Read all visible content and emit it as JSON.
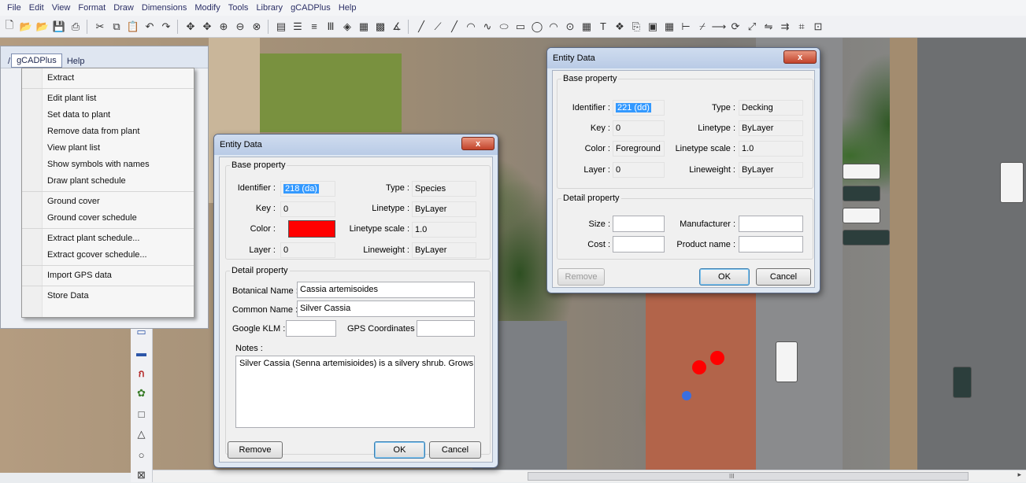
{
  "menubar": [
    "File",
    "Edit",
    "View",
    "Format",
    "Draw",
    "Dimensions",
    "Modify",
    "Tools",
    "Library",
    "gCADPlus",
    "Help"
  ],
  "toolbar_icons": [
    "new-icon",
    "open-icon",
    "open-icon",
    "save-icon",
    "print-icon",
    "cut-icon",
    "copy-icon",
    "paste-icon",
    "undo-icon",
    "redo-icon",
    "pan-icon",
    "pan-icon",
    "zoom-in-icon",
    "zoom-out-icon",
    "zoom-window-icon",
    "layers-icon",
    "properties-icon",
    "lineweight-icon",
    "linetype-icon",
    "color-icon",
    "match-icon",
    "hatch-icon",
    "dimension-icon",
    "line-icon",
    "polyline-icon",
    "line-icon",
    "arc-icon",
    "spline-icon",
    "ellipse-icon",
    "rectangle-icon",
    "circle-icon",
    "arc-icon",
    "donut-icon",
    "table-icon",
    "text-icon",
    "block-icon",
    "insert-icon",
    "image-icon",
    "table-icon",
    "measure-icon",
    "trim-icon",
    "extend-icon",
    "rotate-icon",
    "scale-icon",
    "mirror-icon",
    "offset-icon",
    "snap-icon",
    "osnap-icon"
  ],
  "left_panel": {
    "tabs": [
      "gCADPlus",
      "Help"
    ],
    "active_tab": "gCADPlus",
    "tab_prefix": "/"
  },
  "dropdown": {
    "groups": [
      [
        "Extract"
      ],
      [
        "Edit plant list",
        "Set data to plant",
        "Remove data from plant",
        "View plant list",
        "Show symbols with names",
        "Draw plant schedule"
      ],
      [
        "Ground cover",
        "Ground cover schedule"
      ],
      [
        "Extract plant schedule...",
        "Extract gcover schedule..."
      ],
      [
        "Import GPS data"
      ],
      [
        "Store Data"
      ]
    ]
  },
  "dialog_plant": {
    "title": "Entity Data",
    "close": "x",
    "base_legend": "Base property",
    "identifier_label": "Identifier :",
    "identifier_value": "218 (da)",
    "type_label": "Type :",
    "type_value": "Species",
    "key_label": "Key :",
    "key_value": "0",
    "linetype_label": "Linetype :",
    "linetype_value": "ByLayer",
    "color_label": "Color :",
    "color_value": "#ff0000",
    "ltscale_label": "Linetype scale :",
    "ltscale_value": "1.0",
    "layer_label": "Layer :",
    "layer_value": "0",
    "lineweight_label": "Lineweight :",
    "lineweight_value": "ByLayer",
    "detail_legend": "Detail property",
    "botanical_label": "Botanical Name :",
    "botanical_value": "Cassia artemisoides",
    "common_label": "Common Name :",
    "common_value": "Silver Cassia",
    "klm_label": "Google KLM :",
    "klm_value": "",
    "gps_label": "GPS Coordinates :",
    "gps_value": "",
    "notes_label": "Notes :",
    "notes_value": "Silver Cassia (Senna artemisioides) is a silvery shrub. Grows to",
    "remove": "Remove",
    "ok": "OK",
    "cancel": "Cancel"
  },
  "dialog_deck": {
    "title": "Entity Data",
    "close": "x",
    "base_legend": "Base property",
    "identifier_label": "Identifier :",
    "identifier_value": "221 (dd)",
    "type_label": "Type :",
    "type_value": "Decking",
    "key_label": "Key :",
    "key_value": "0",
    "linetype_label": "Linetype :",
    "linetype_value": "ByLayer",
    "color_label": "Color :",
    "color_value": "Foreground",
    "ltscale_label": "Linetype scale :",
    "ltscale_value": "1.0",
    "layer_label": "Layer :",
    "layer_value": "0",
    "lineweight_label": "Lineweight :",
    "lineweight_value": "ByLayer",
    "detail_legend": "Detail property",
    "size_label": "Size :",
    "size_value": "",
    "manufacturer_label": "Manufacturer :",
    "manufacturer_value": "",
    "cost_label": "Cost :",
    "cost_value": "",
    "product_label": "Product name :",
    "product_value": "",
    "remove": "Remove",
    "ok": "OK",
    "cancel": "Cancel"
  },
  "canvas": {
    "plant_marker_color": "#ff0000",
    "scroll_mark": "III"
  },
  "colors": {
    "menu_text": "#2b2f66",
    "dialog_bg": "#dfe8f3",
    "close_red": "#c2432b",
    "selection": "#3399ff"
  }
}
